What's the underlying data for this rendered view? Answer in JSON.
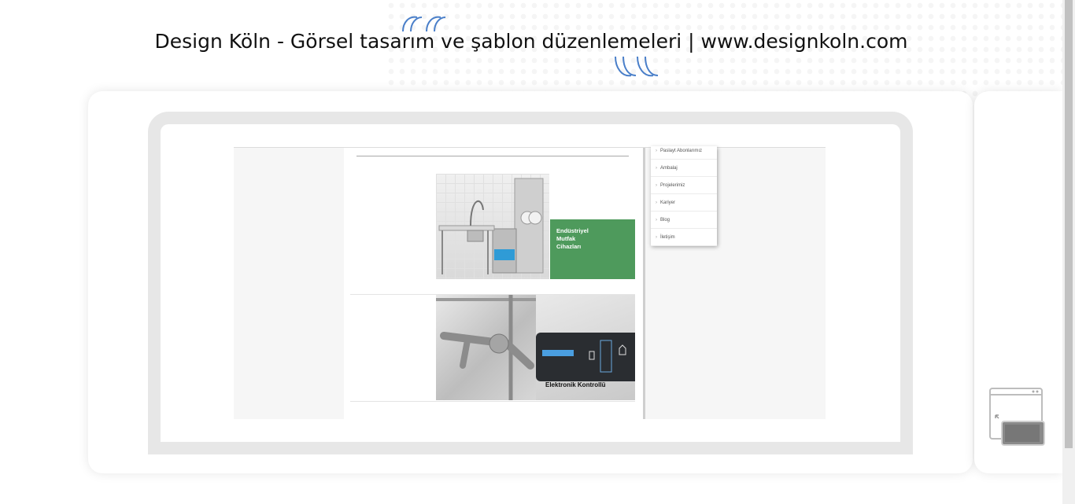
{
  "page": {
    "title": "Design Köln - Görsel tasarım ve şablon düzenlemeleri | www.designkoln.com"
  },
  "preview": {
    "menu_items": [
      "Paslayt Abonlarımız",
      "Ambalaj",
      "Projelerimiz",
      "Kariyer",
      "Blog",
      "İletişim"
    ],
    "product_1": {
      "label_lines": [
        "Endüstriyel",
        "Mutfak",
        "Cihazları"
      ],
      "accent_color": "#4e9a5c"
    },
    "product_2": {
      "label": "Elektronik Kontrollü"
    }
  },
  "controls": {
    "device_toggle_icon": "browser-mobile-switch-icon"
  },
  "colors": {
    "accent_blue": "#4a7fc9",
    "frame_gray": "#e7e7e7"
  }
}
